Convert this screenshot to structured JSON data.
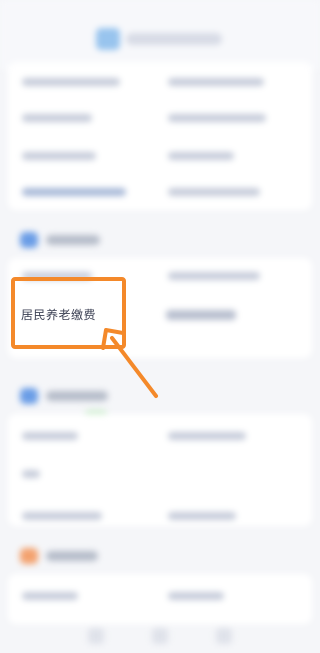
{
  "highlighted_item": {
    "label": "居民养老缴费"
  },
  "annotation": {
    "color": "#f4892a"
  },
  "colors": {
    "background": "#f5f6f9",
    "section_icon_blue": "#6a9de6",
    "section_icon_orange": "#f3a26f",
    "accent_green": "#c9ecca"
  }
}
